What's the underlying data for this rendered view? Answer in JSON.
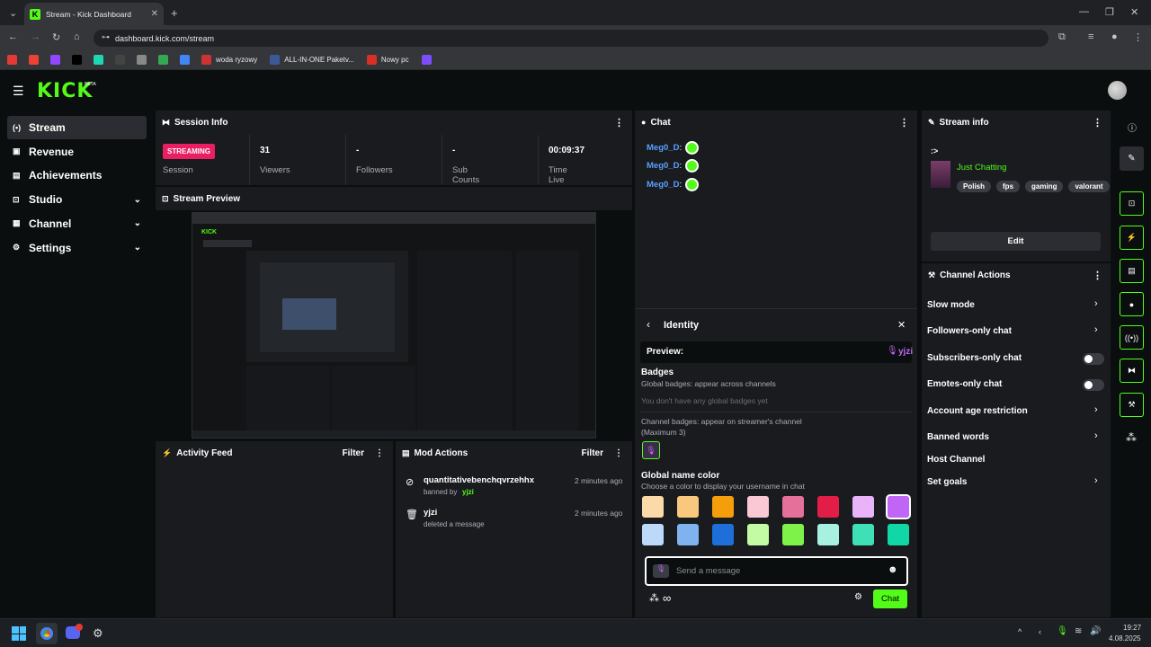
{
  "browser": {
    "tab_title": "Stream - Kick Dashboard",
    "url": "dashboard.kick.com/stream",
    "bookmarks": [
      {
        "label": "",
        "color": "#e53935"
      },
      {
        "label": "",
        "color": "#ea4335"
      },
      {
        "label": "",
        "color": "#9146ff"
      },
      {
        "label": "",
        "color": "#000000"
      },
      {
        "label": "",
        "color": "#1ed6b0"
      },
      {
        "label": "",
        "color": "#444444"
      },
      {
        "label": "",
        "color": "#888888"
      },
      {
        "label": "",
        "color": "#34a853"
      },
      {
        "label": "",
        "color": "#4285f4"
      },
      {
        "label": "woda ryzowy",
        "color": "#cc3333"
      },
      {
        "label": "ALL-IN-ONE Paketv...",
        "color": "#3b5998"
      },
      {
        "label": "Nowy pc",
        "color": "#d93025"
      },
      {
        "label": "",
        "color": "#7c4dff"
      }
    ]
  },
  "brand": {
    "logo": "KICK",
    "beta": "BETA",
    "accent": "#53fc18"
  },
  "sidebar": {
    "items": [
      {
        "label": "Stream",
        "icon": "broadcast-icon",
        "expandable": false,
        "active": true
      },
      {
        "label": "Revenue",
        "icon": "wallet-icon",
        "expandable": false
      },
      {
        "label": "Achievements",
        "icon": "trophy-icon",
        "expandable": false
      },
      {
        "label": "Studio",
        "icon": "studio-icon",
        "expandable": true
      },
      {
        "label": "Channel",
        "icon": "channel-icon",
        "expandable": true
      },
      {
        "label": "Settings",
        "icon": "gear-icon",
        "expandable": true
      }
    ]
  },
  "session": {
    "title": "Session Info",
    "status": "STREAMING",
    "status_label": "Session",
    "viewers": "31",
    "viewers_label": "Viewers",
    "followers": "-",
    "followers_label": "Followers",
    "subs": "-",
    "subs_label": "Sub Counts",
    "time": "00:09:37",
    "time_label": "Time Live"
  },
  "preview": {
    "title": "Stream Preview"
  },
  "activity": {
    "title": "Activity Feed",
    "filter": "Filter"
  },
  "mod": {
    "title": "Mod Actions",
    "filter": "Filter",
    "entries": [
      {
        "user": "quantitativebenchqvrzehhx",
        "action": "banned by",
        "by": "yjzi",
        "time": "2 minutes ago",
        "icon": "ban-icon"
      },
      {
        "user": "yjzi",
        "action": "deleted a message",
        "by": "",
        "time": "2 minutes ago",
        "icon": "trash-icon"
      }
    ]
  },
  "chat": {
    "title": "Chat",
    "messages": [
      {
        "user": "Meg0_D",
        "sep": ":"
      },
      {
        "user": "Meg0_D",
        "sep": ":"
      },
      {
        "user": "Meg0_D",
        "sep": ":"
      }
    ],
    "identity": {
      "title": "Identity",
      "preview_label": "Preview:",
      "preview_name": "yjzi",
      "badges_title": "Badges",
      "global_badges_desc": "Global badges: appear across channels",
      "no_global": "You don't have any global badges yet",
      "channel_badges_desc": "Channel badges: appear on streamer's channel",
      "channel_badges_max": "(Maximum 3)",
      "color_title": "Global name color",
      "color_desc": "Choose a color to display your username in chat",
      "colors": [
        "#fcd9a8",
        "#f9c77d",
        "#f59e0b",
        "#f9c8d4",
        "#e5719a",
        "#e11d48",
        "#e9b3f9",
        "#c165f6",
        "#bcd9f9",
        "#7fb3f0",
        "#1e6fd9",
        "#c2fba4",
        "#7ef249",
        "#a8f0e0",
        "#3fe0b6",
        "#11d6a5"
      ],
      "selected_color": 7
    },
    "input_placeholder": "Send a message",
    "send_label": "Chat"
  },
  "stream_info": {
    "title": "Stream info",
    "stream_title": ":>",
    "category": "Just Chatting",
    "tags": [
      "Polish",
      "fps",
      "gaming",
      "valorant"
    ],
    "edit_label": "Edit"
  },
  "channel_actions": {
    "title": "Channel Actions",
    "items": [
      {
        "label": "Slow mode",
        "control": "chevron"
      },
      {
        "label": "Followers-only chat",
        "control": "chevron"
      },
      {
        "label": "Subscribers-only chat",
        "control": "toggle"
      },
      {
        "label": "Emotes-only chat",
        "control": "toggle"
      },
      {
        "label": "Account age restriction",
        "control": "chevron"
      },
      {
        "label": "Banned words",
        "control": "chevron"
      },
      {
        "label": "Host Channel",
        "control": "none"
      },
      {
        "label": "Set goals",
        "control": "chevron"
      }
    ]
  },
  "taskbar": {
    "time": "19:27",
    "date": "4.08.2025"
  }
}
